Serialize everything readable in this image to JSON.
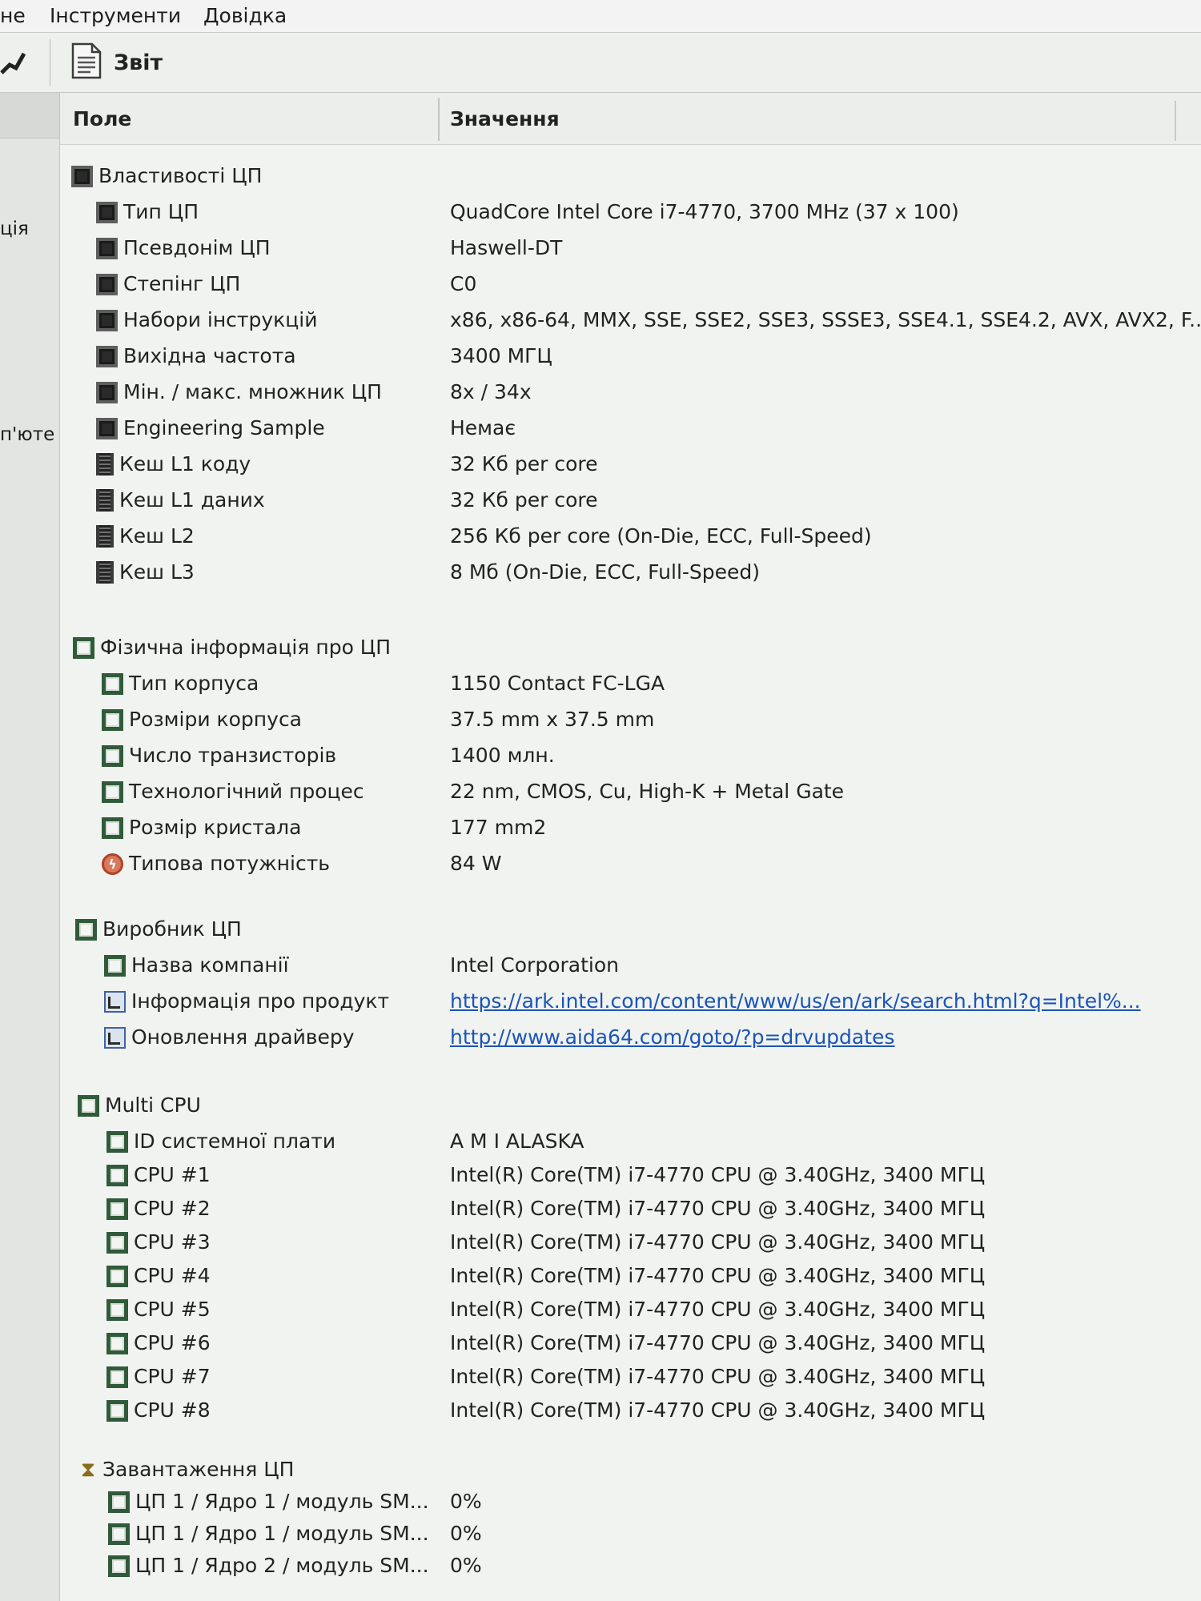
{
  "menu": {
    "items": [
      "не",
      "Інструменти",
      "Довідка"
    ]
  },
  "toolbar": {
    "report_label": "Звіт"
  },
  "left_panel": {
    "fragments": [
      "ція",
      "п'юте"
    ]
  },
  "table": {
    "columns": {
      "field": "Поле",
      "value": "Значення"
    },
    "rows": [
      {
        "level": 0,
        "icon": "cpu-icon",
        "field": "Властивості ЦП",
        "value": ""
      },
      {
        "level": 1,
        "icon": "cpu-icon",
        "field": "Тип ЦП",
        "value": "QuadCore Intel Core i7-4770, 3700 MHz (37 x 100)"
      },
      {
        "level": 1,
        "icon": "cpu-icon",
        "field": "Псевдонім ЦП",
        "value": "Haswell-DT"
      },
      {
        "level": 1,
        "icon": "cpu-icon",
        "field": "Степінг ЦП",
        "value": "C0"
      },
      {
        "level": 1,
        "icon": "cpu-icon",
        "field": "Набори інструкцій",
        "value": "x86, x86-64, MMX, SSE, SSE2, SSE3, SSSE3, SSE4.1, SSE4.2, AVX, AVX2, F..."
      },
      {
        "level": 1,
        "icon": "cpu-icon",
        "field": "Вихідна частота",
        "value": "3400 МГЦ"
      },
      {
        "level": 1,
        "icon": "cpu-icon",
        "field": "Мін. / макс. множник ЦП",
        "value": "8x / 34x"
      },
      {
        "level": 1,
        "icon": "cpu-icon",
        "field": "Engineering Sample",
        "value": "Немає"
      },
      {
        "level": 1,
        "icon": "cache-icon",
        "field": "Кеш L1 коду",
        "value": "32 Кб per core"
      },
      {
        "level": 1,
        "icon": "cache-icon",
        "field": "Кеш L1 даних",
        "value": "32 Кб per core"
      },
      {
        "level": 1,
        "icon": "cache-icon",
        "field": "Кеш L2",
        "value": "256 Кб per core  (On-Die, ECC, Full-Speed)"
      },
      {
        "level": 1,
        "icon": "cache-icon",
        "field": "Кеш L3",
        "value": "8 Мб  (On-Die, ECC, Full-Speed)"
      },
      {
        "level": 0,
        "icon": "cpu-green-icon",
        "field": "Фізична інформація про ЦП",
        "value": ""
      },
      {
        "level": 1,
        "icon": "cpu-green-icon",
        "field": "Тип корпуса",
        "value": "1150 Contact FC-LGA"
      },
      {
        "level": 1,
        "icon": "cpu-green-icon",
        "field": "Розміри корпуса",
        "value": "37.5 mm x 37.5 mm"
      },
      {
        "level": 1,
        "icon": "cpu-green-icon",
        "field": "Число транзисторів",
        "value": "1400 млн."
      },
      {
        "level": 1,
        "icon": "cpu-green-icon",
        "field": "Технологічний процес",
        "value": "22 nm, CMOS, Cu, High-K + Metal Gate"
      },
      {
        "level": 1,
        "icon": "cpu-green-icon",
        "field": "Розмір кристала",
        "value": "177 mm2"
      },
      {
        "level": 1,
        "icon": "power-icon",
        "field": "Типова потужність",
        "value": "84 W"
      },
      {
        "level": 0,
        "icon": "cpu-green-icon",
        "field": "Виробник ЦП",
        "value": ""
      },
      {
        "level": 1,
        "icon": "cpu-green-icon",
        "field": "Назва компанії",
        "value": "Intel Corporation"
      },
      {
        "level": 1,
        "icon": "link-icon",
        "field": "Інформація про продукт",
        "value": "https://ark.intel.com/content/www/us/en/ark/search.html?q=Intel%..."
      },
      {
        "level": 1,
        "icon": "link-icon",
        "field": "Оновлення драйверу",
        "value": "http://www.aida64.com/goto/?p=drvupdates"
      },
      {
        "level": 0,
        "icon": "cpu-green-icon",
        "field": "Multi CPU",
        "value": ""
      },
      {
        "level": 1,
        "icon": "cpu-green-icon",
        "field": "ID системної плати",
        "value": "A M I ALASKA"
      },
      {
        "level": 1,
        "icon": "cpu-green-icon",
        "field": "CPU #1",
        "value": "Intel(R) Core(TM) i7-4770 CPU @ 3.40GHz, 3400 МГЦ"
      },
      {
        "level": 1,
        "icon": "cpu-green-icon",
        "field": "CPU #2",
        "value": "Intel(R) Core(TM) i7-4770 CPU @ 3.40GHz, 3400 МГЦ"
      },
      {
        "level": 1,
        "icon": "cpu-green-icon",
        "field": "CPU #3",
        "value": "Intel(R) Core(TM) i7-4770 CPU @ 3.40GHz, 3400 МГЦ"
      },
      {
        "level": 1,
        "icon": "cpu-green-icon",
        "field": "CPU #4",
        "value": "Intel(R) Core(TM) i7-4770 CPU @ 3.40GHz, 3400 МГЦ"
      },
      {
        "level": 1,
        "icon": "cpu-green-icon",
        "field": "CPU #5",
        "value": "Intel(R) Core(TM) i7-4770 CPU @ 3.40GHz, 3400 МГЦ"
      },
      {
        "level": 1,
        "icon": "cpu-green-icon",
        "field": "CPU #6",
        "value": "Intel(R) Core(TM) i7-4770 CPU @ 3.40GHz, 3400 МГЦ"
      },
      {
        "level": 1,
        "icon": "cpu-green-icon",
        "field": "CPU #7",
        "value": "Intel(R) Core(TM) i7-4770 CPU @ 3.40GHz, 3400 МГЦ"
      },
      {
        "level": 1,
        "icon": "cpu-green-icon",
        "field": "CPU #8",
        "value": "Intel(R) Core(TM) i7-4770 CPU @ 3.40GHz, 3400 МГЦ"
      },
      {
        "level": 0,
        "icon": "hourglass-icon",
        "field": "Завантаження ЦП",
        "value": ""
      },
      {
        "level": 1,
        "icon": "cpu-green-icon",
        "field": "ЦП 1 / Ядро 1 / модуль SM...",
        "value": "0%"
      },
      {
        "level": 1,
        "icon": "cpu-green-icon",
        "field": "ЦП 1 / Ядро 1 / модуль SM...",
        "value": "0%"
      },
      {
        "level": 1,
        "icon": "cpu-green-icon",
        "field": "ЦП 1 / Ядро 2 / модуль SM...",
        "value": "0%"
      }
    ]
  }
}
